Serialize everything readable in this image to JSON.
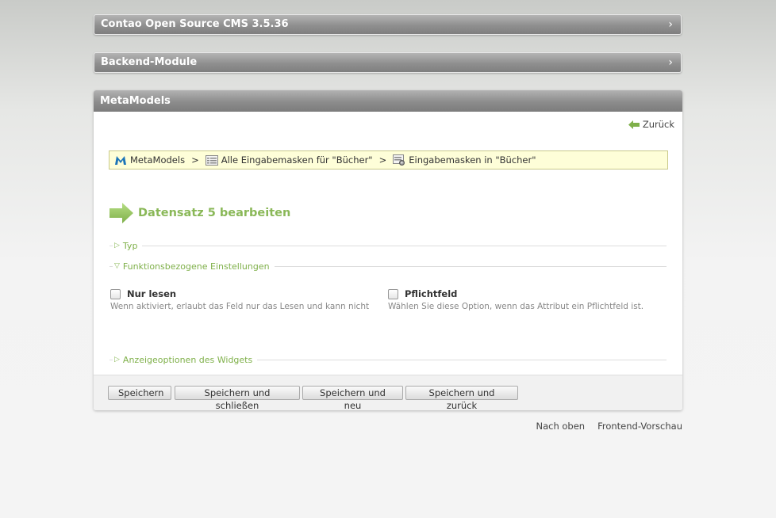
{
  "panels": {
    "cms_title": "Contao Open Source CMS 3.5.36",
    "backend_modules": "Backend-Module",
    "chevron": "›"
  },
  "main": {
    "title": "MetaModels",
    "back_label": "Zurück",
    "breadcrumb": {
      "items": [
        "MetaModels",
        "Alle Eingabemasken für \"Bücher\"",
        "Eingabemasken in \"Bücher\""
      ],
      "separator": ">"
    },
    "heading": "Datensatz 5 bearbeiten",
    "legends": {
      "typ": "Typ",
      "func": "Funktionsbezogene Einstellungen",
      "widget": "Anzeigeoptionen des Widgets"
    },
    "legend_open_icon": "▽",
    "legend_closed_icon": "▷",
    "fields": {
      "readonly": {
        "label": "Nur lesen",
        "help": "Wenn aktiviert, erlaubt das Feld nur das Lesen und kann nicht"
      },
      "mandatory": {
        "label": "Pflichtfeld",
        "help": "Wählen Sie diese Option, wenn das Attribut ein Pflichtfeld ist."
      }
    },
    "buttons": {
      "save": "Speichern",
      "save_close": "Speichern und schließen",
      "save_new": "Speichern und neu",
      "save_back": "Speichern und zurück"
    }
  },
  "footer": {
    "top": "Nach oben",
    "preview": "Frontend-Vorschau"
  },
  "colors": {
    "accent_green": "#8ab858",
    "header_gray": "#8f8f8f",
    "breadcrumb_bg": "#fefed8"
  }
}
